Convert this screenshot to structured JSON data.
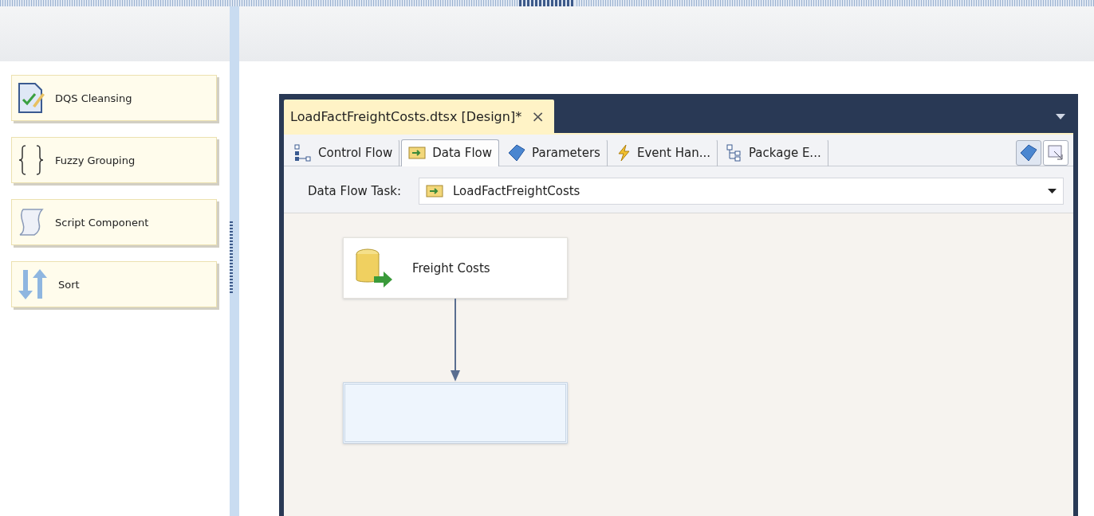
{
  "toolbox": {
    "items": [
      {
        "label": "DQS Cleansing",
        "kind": "dqs"
      },
      {
        "label": "Fuzzy Grouping",
        "kind": "braces"
      },
      {
        "label": "Script Component",
        "kind": "script"
      },
      {
        "label": "Sort",
        "kind": "sort"
      }
    ]
  },
  "document": {
    "tab": {
      "title": "LoadFactFreightCosts.dtsx [Design]*",
      "close": "×"
    },
    "designer_tabs": [
      {
        "label": "Control Flow",
        "kind": "control",
        "selected": false
      },
      {
        "label": "Data Flow",
        "kind": "data",
        "selected": true
      },
      {
        "label": "Parameters",
        "kind": "parameters",
        "selected": false
      },
      {
        "label": "Event Han...",
        "kind": "event",
        "selected": false
      },
      {
        "label": "Package E...",
        "kind": "explorer",
        "selected": false
      }
    ],
    "task": {
      "label": "Data Flow Task:",
      "value": "LoadFactFreightCosts"
    },
    "canvas": {
      "nodes": [
        {
          "label": "Freight Costs",
          "kind": "source"
        },
        {
          "kind": "empty"
        }
      ]
    }
  }
}
